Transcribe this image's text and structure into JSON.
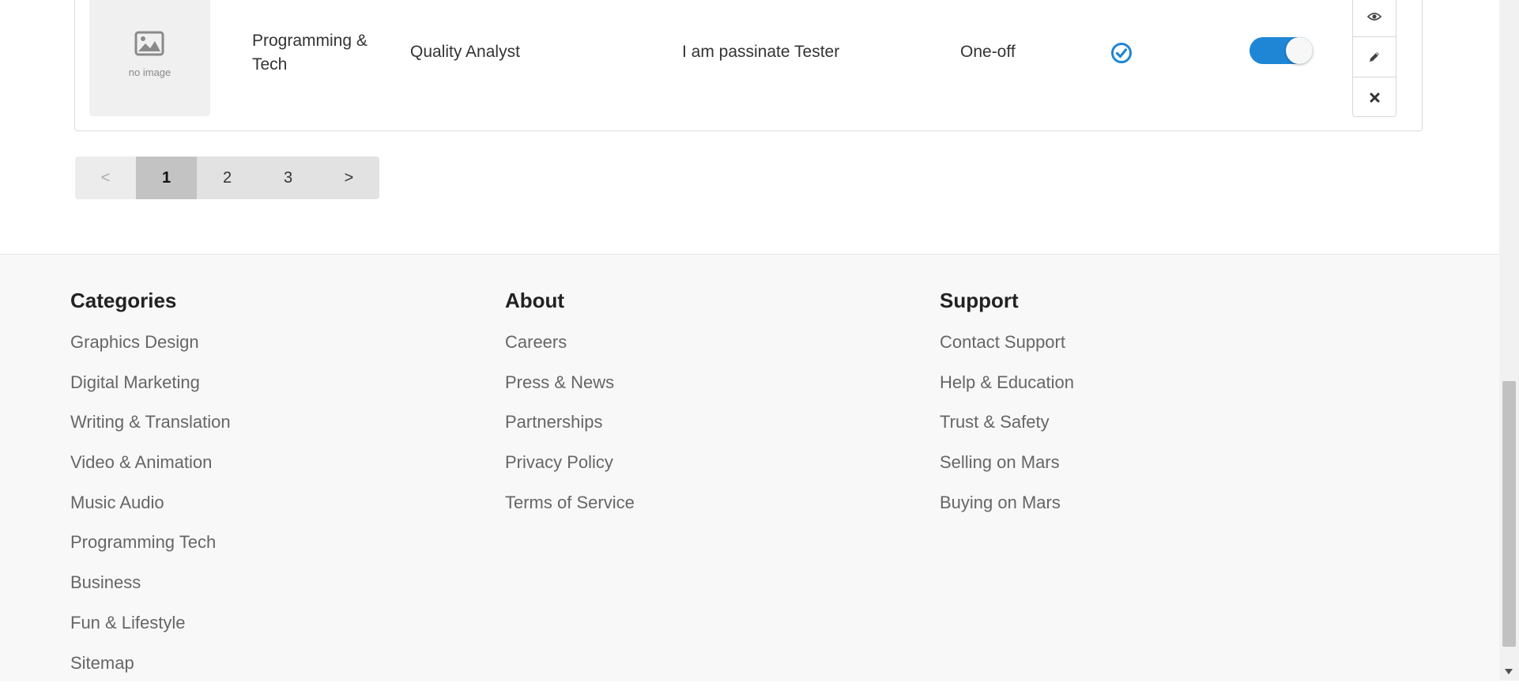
{
  "row": {
    "thumbnail_text": "no image",
    "category": "Programming & Tech",
    "title": "Quality Analyst",
    "description": "I am passinate Tester",
    "type": "One-off",
    "status_verified": true,
    "toggle_on": true
  },
  "pagination": {
    "prev": "<",
    "pages": [
      "1",
      "2",
      "3"
    ],
    "active": "1",
    "next": ">"
  },
  "footer": {
    "categories": {
      "heading": "Categories",
      "items": [
        "Graphics Design",
        "Digital Marketing",
        "Writing & Translation",
        "Video & Animation",
        "Music Audio",
        "Programming Tech",
        "Business",
        "Fun & Lifestyle",
        "Sitemap"
      ]
    },
    "about": {
      "heading": "About",
      "items": [
        "Careers",
        "Press & News",
        "Partnerships",
        "Privacy Policy",
        "Terms of Service"
      ]
    },
    "support": {
      "heading": "Support",
      "items": [
        "Contact Support",
        "Help & Education",
        "Trust & Safety",
        "Selling on Mars",
        "Buying on Mars"
      ]
    }
  },
  "colors": {
    "accent": "#1f86d6",
    "footer_bg": "#f8f8f8",
    "pager_active": "#c3c3c3"
  }
}
